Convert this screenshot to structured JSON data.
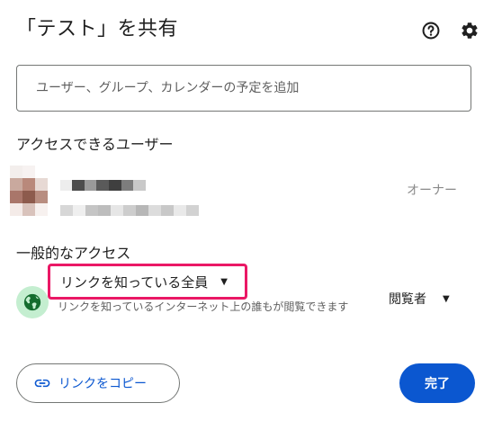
{
  "dialog": {
    "title": "「テスト」を共有",
    "help_icon": "help-circle-icon",
    "settings_icon": "gear-icon"
  },
  "add_people": {
    "placeholder": "ユーザー、グループ、カレンダーの予定を追加"
  },
  "people_section": {
    "title": "アクセスできるユーザー",
    "owner": {
      "avatar_icon": "user-avatar-pixelated",
      "role": "オーナー"
    }
  },
  "general_access": {
    "title": "一般的なアクセス",
    "globe_icon": "globe-icon",
    "link_setting": "リンクを知っている全員",
    "description": "リンクを知っているインターネット上の誰もが閲覧できます",
    "role": "閲覧者"
  },
  "footer": {
    "copy_link_label": "リンクをコピー",
    "copy_link_icon": "link-icon",
    "done_label": "完了"
  },
  "colors": {
    "accent_blue": "#0b57d0",
    "highlight_pink": "#ea1865",
    "globe_bg": "#c4eed0"
  }
}
